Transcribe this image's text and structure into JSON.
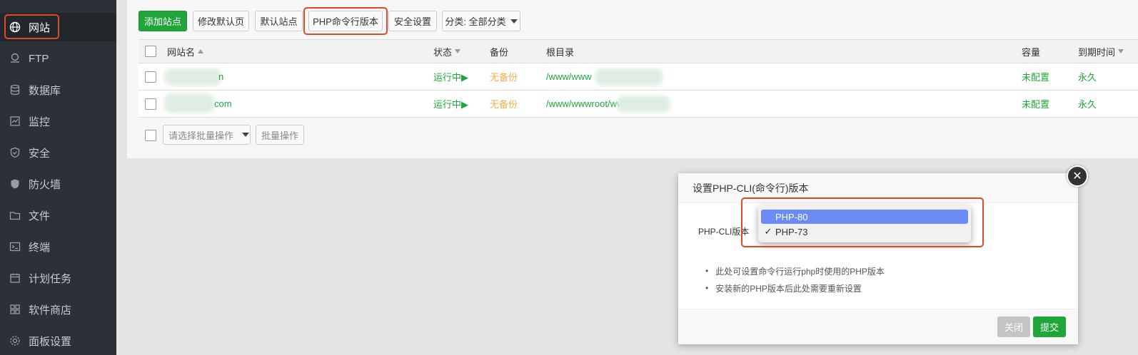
{
  "sidebar": {
    "items": [
      {
        "label": "网站",
        "icon": "globe-icon"
      },
      {
        "label": "FTP",
        "icon": "ftp-icon"
      },
      {
        "label": "数据库",
        "icon": "database-icon"
      },
      {
        "label": "监控",
        "icon": "monitor-icon"
      },
      {
        "label": "安全",
        "icon": "shield-icon"
      },
      {
        "label": "防火墙",
        "icon": "firewall-icon"
      },
      {
        "label": "文件",
        "icon": "folder-icon"
      },
      {
        "label": "终端",
        "icon": "terminal-icon"
      },
      {
        "label": "计划任务",
        "icon": "calendar-icon"
      },
      {
        "label": "软件商店",
        "icon": "apps-icon"
      },
      {
        "label": "面板设置",
        "icon": "gear-icon"
      }
    ]
  },
  "toolbar": {
    "add_site": "添加站点",
    "edit_default_page": "修改默认页",
    "default_site": "默认站点",
    "php_cli_version": "PHP命令行版本",
    "security_settings": "安全设置",
    "category_filter": "分类: 全部分类"
  },
  "table": {
    "headers": {
      "site_name": "网站名",
      "status": "状态",
      "backup": "备份",
      "root_dir": "根目录",
      "capacity": "容量",
      "expiry": "到期时间"
    },
    "rows": [
      {
        "site_name": "n",
        "status": "运行中▶",
        "backup": "无备份",
        "root_dir": "/www/www",
        "capacity": "未配置",
        "expiry": "永久"
      },
      {
        "site_name": "com",
        "status": "运行中▶",
        "backup": "无备份",
        "root_dir": "/www/wwwroot/ww",
        "capacity": "未配置",
        "expiry": "永久"
      }
    ],
    "batch_placeholder": "请选择批量操作",
    "batch_button": "批量操作"
  },
  "modal": {
    "title": "设置PHP-CLI(命令行)版本",
    "field_label": "PHP-CLI版本",
    "options": [
      "PHP-80",
      "PHP-73"
    ],
    "highlighted_option": "PHP-80",
    "checked_option": "PHP-73",
    "notes": [
      "此处可设置命令行运行php时使用的PHP版本",
      "安装新的PHP版本后此处需要重新设置"
    ],
    "close_button": "关闭",
    "submit_button": "提交"
  },
  "colors": {
    "accent_green": "#20a53a",
    "highlight_red": "#e0472d",
    "warning_orange": "#f0ad4e",
    "sidebar_bg": "#2c3138",
    "dropdown_select": "#6d8bf5"
  }
}
